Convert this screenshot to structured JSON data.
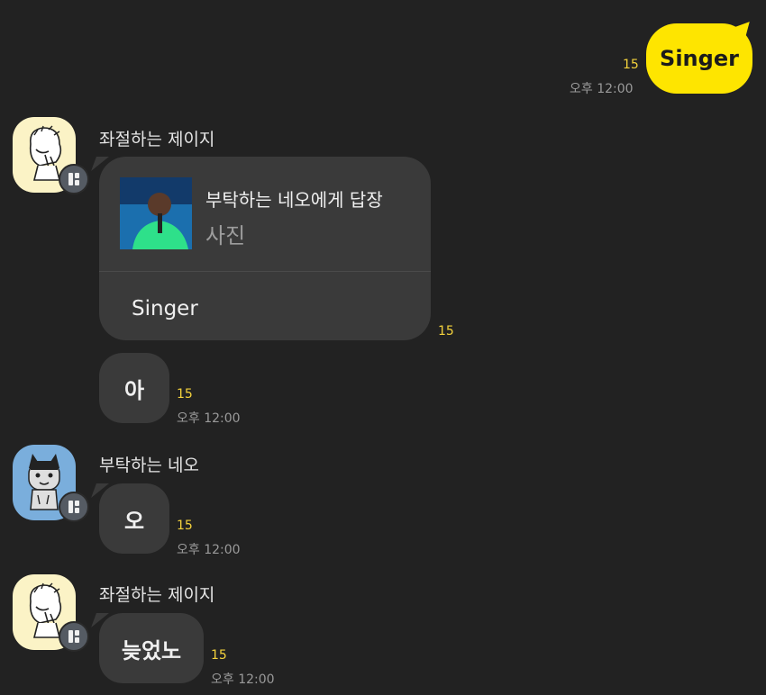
{
  "messages": {
    "outgoing": {
      "text": "Singer",
      "unread": "15",
      "time": "오후 12:00"
    },
    "group1": {
      "sender": "좌절하는 제이지",
      "reply": {
        "title": "부탁하는 네오에게 답장",
        "subtitle": "사진",
        "body": "Singer",
        "unread": "15"
      },
      "second": {
        "text": "아",
        "unread": "15",
        "time": "오후 12:00"
      }
    },
    "group2": {
      "sender": "부탁하는 네오",
      "text": "오",
      "unread": "15",
      "time": "오후 12:00"
    },
    "group3": {
      "sender": "좌절하는 제이지",
      "text": "늦었노",
      "unread": "15",
      "time": "오후 12:00"
    }
  },
  "colors": {
    "background": "#222222",
    "outgoing_bubble": "#fee500",
    "incoming_bubble": "#3a3a3a",
    "unread_count": "#f4d23c"
  }
}
